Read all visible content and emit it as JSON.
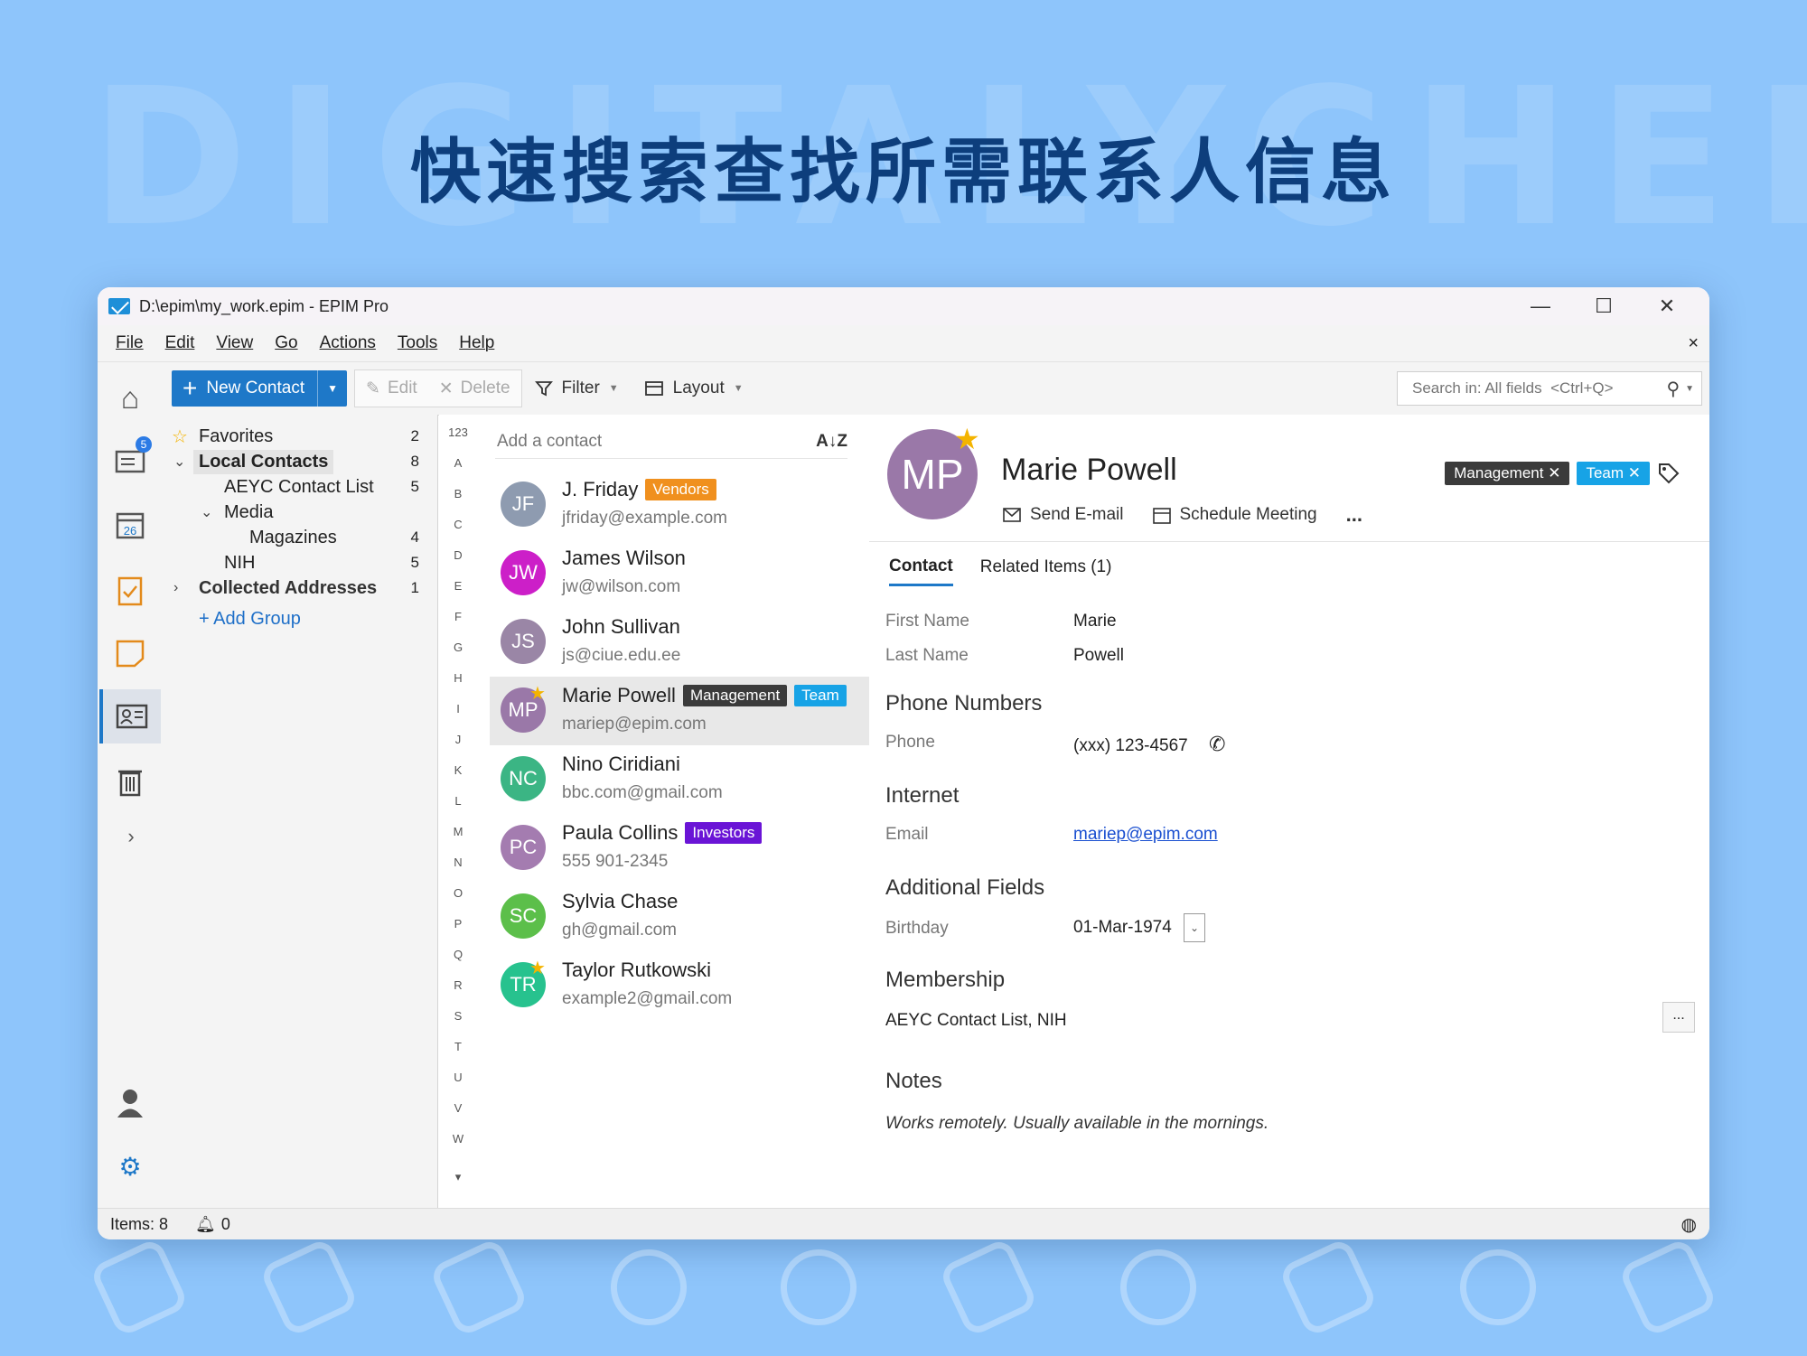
{
  "banner": {
    "watermark": "DIGITALYCHEE",
    "headline": "快速搜索查找所需联系人信息"
  },
  "window": {
    "title": "D:\\epim\\my_work.epim - EPIM Pro",
    "minimize": "—",
    "maximize": "☐",
    "close": "✕"
  },
  "menu": {
    "items": [
      "File",
      "Edit",
      "View",
      "Go",
      "Actions",
      "Tools",
      "Help"
    ],
    "close": "×"
  },
  "sidebar_icons": {
    "mail_badge": "5",
    "calendar_day": "26",
    "expand": "›"
  },
  "toolbar": {
    "new_contact": "New Contact",
    "edit": "Edit",
    "delete": "Delete",
    "filter": "Filter",
    "layout": "Layout",
    "search_placeholder": "Search in: All fields  <Ctrl+Q>"
  },
  "folders": {
    "items": [
      {
        "name": "Favorites",
        "count": "2"
      },
      {
        "name": "Local Contacts",
        "count": "8"
      },
      {
        "name": "AEYC Contact List",
        "count": "5"
      },
      {
        "name": "Media",
        "count": ""
      },
      {
        "name": "Magazines",
        "count": "4"
      },
      {
        "name": "NIH",
        "count": "5"
      },
      {
        "name": "Collected Addresses",
        "count": "1"
      }
    ],
    "add_group": "+ Add Group"
  },
  "alphabet": [
    "123",
    "A",
    "B",
    "C",
    "D",
    "E",
    "F",
    "G",
    "H",
    "I",
    "J",
    "K",
    "L",
    "M",
    "N",
    "O",
    "P",
    "Q",
    "R",
    "S",
    "T",
    "U",
    "V",
    "W",
    "▾"
  ],
  "contact_list": {
    "add_placeholder": "Add a contact",
    "sort_icon": "A↓Z",
    "contacts": [
      {
        "initials": "JF",
        "name": "J. Friday",
        "sub": "jfriday@example.com",
        "color": "#8e9bb0",
        "star": false,
        "tags": [
          {
            "label": "Vendors",
            "color": "#f0901e"
          }
        ]
      },
      {
        "initials": "JW",
        "name": "James Wilson",
        "sub": "jw@wilson.com",
        "color": "#cc1fc8",
        "star": false,
        "tags": []
      },
      {
        "initials": "JS",
        "name": "John Sullivan",
        "sub": "js@ciue.edu.ee",
        "color": "#9a86a6",
        "star": false,
        "tags": []
      },
      {
        "initials": "MP",
        "name": "Marie Powell",
        "sub": "mariep@epim.com",
        "color": "#9a78a8",
        "star": true,
        "tags": [
          {
            "label": "Management",
            "color": "#3b3b3b"
          },
          {
            "label": "Team",
            "color": "#17a3e6"
          }
        ]
      },
      {
        "initials": "NC",
        "name": "Nino Ciridiani",
        "sub": "bbc.com@gmail.com",
        "color": "#3bb584",
        "star": false,
        "tags": []
      },
      {
        "initials": "PC",
        "name": "Paula Collins",
        "sub": "555 901-2345",
        "color": "#a47cb0",
        "star": false,
        "tags": [
          {
            "label": "Investors",
            "color": "#6a14d6"
          }
        ]
      },
      {
        "initials": "SC",
        "name": "Sylvia Chase",
        "sub": "gh@gmail.com",
        "color": "#5cbf4a",
        "star": false,
        "tags": []
      },
      {
        "initials": "TR",
        "name": "Taylor Rutkowski",
        "sub": "example2@gmail.com",
        "color": "#27c28e",
        "star": true,
        "tags": []
      }
    ]
  },
  "details": {
    "initials": "MP",
    "name": "Marie Powell",
    "send_email": "Send E-mail",
    "schedule": "Schedule Meeting",
    "more": "...",
    "tags": [
      {
        "label": "Management ✕",
        "color": "#3b3b3b"
      },
      {
        "label": "Team ✕",
        "color": "#17a3e6"
      }
    ],
    "tabs": [
      "Contact",
      "Related Items  (1)"
    ],
    "first_name_label": "First Name",
    "first_name": "Marie",
    "last_name_label": "Last Name",
    "last_name": "Powell",
    "phone_section": "Phone Numbers",
    "phone_label": "Phone",
    "phone": "(xxx) 123-4567",
    "internet_section": "Internet",
    "email_label": "Email",
    "email": "mariep@epim.com",
    "additional_section": "Additional Fields",
    "birthday_label": "Birthday",
    "birthday": "01-Mar-1974",
    "membership_section": "Membership",
    "membership": "AEYC Contact List, NIH",
    "membership_more": "...",
    "notes_section": "Notes",
    "notes": "Works remotely. Usually available in the mornings."
  },
  "status": {
    "items": "Items: 8",
    "notifications": "0"
  }
}
